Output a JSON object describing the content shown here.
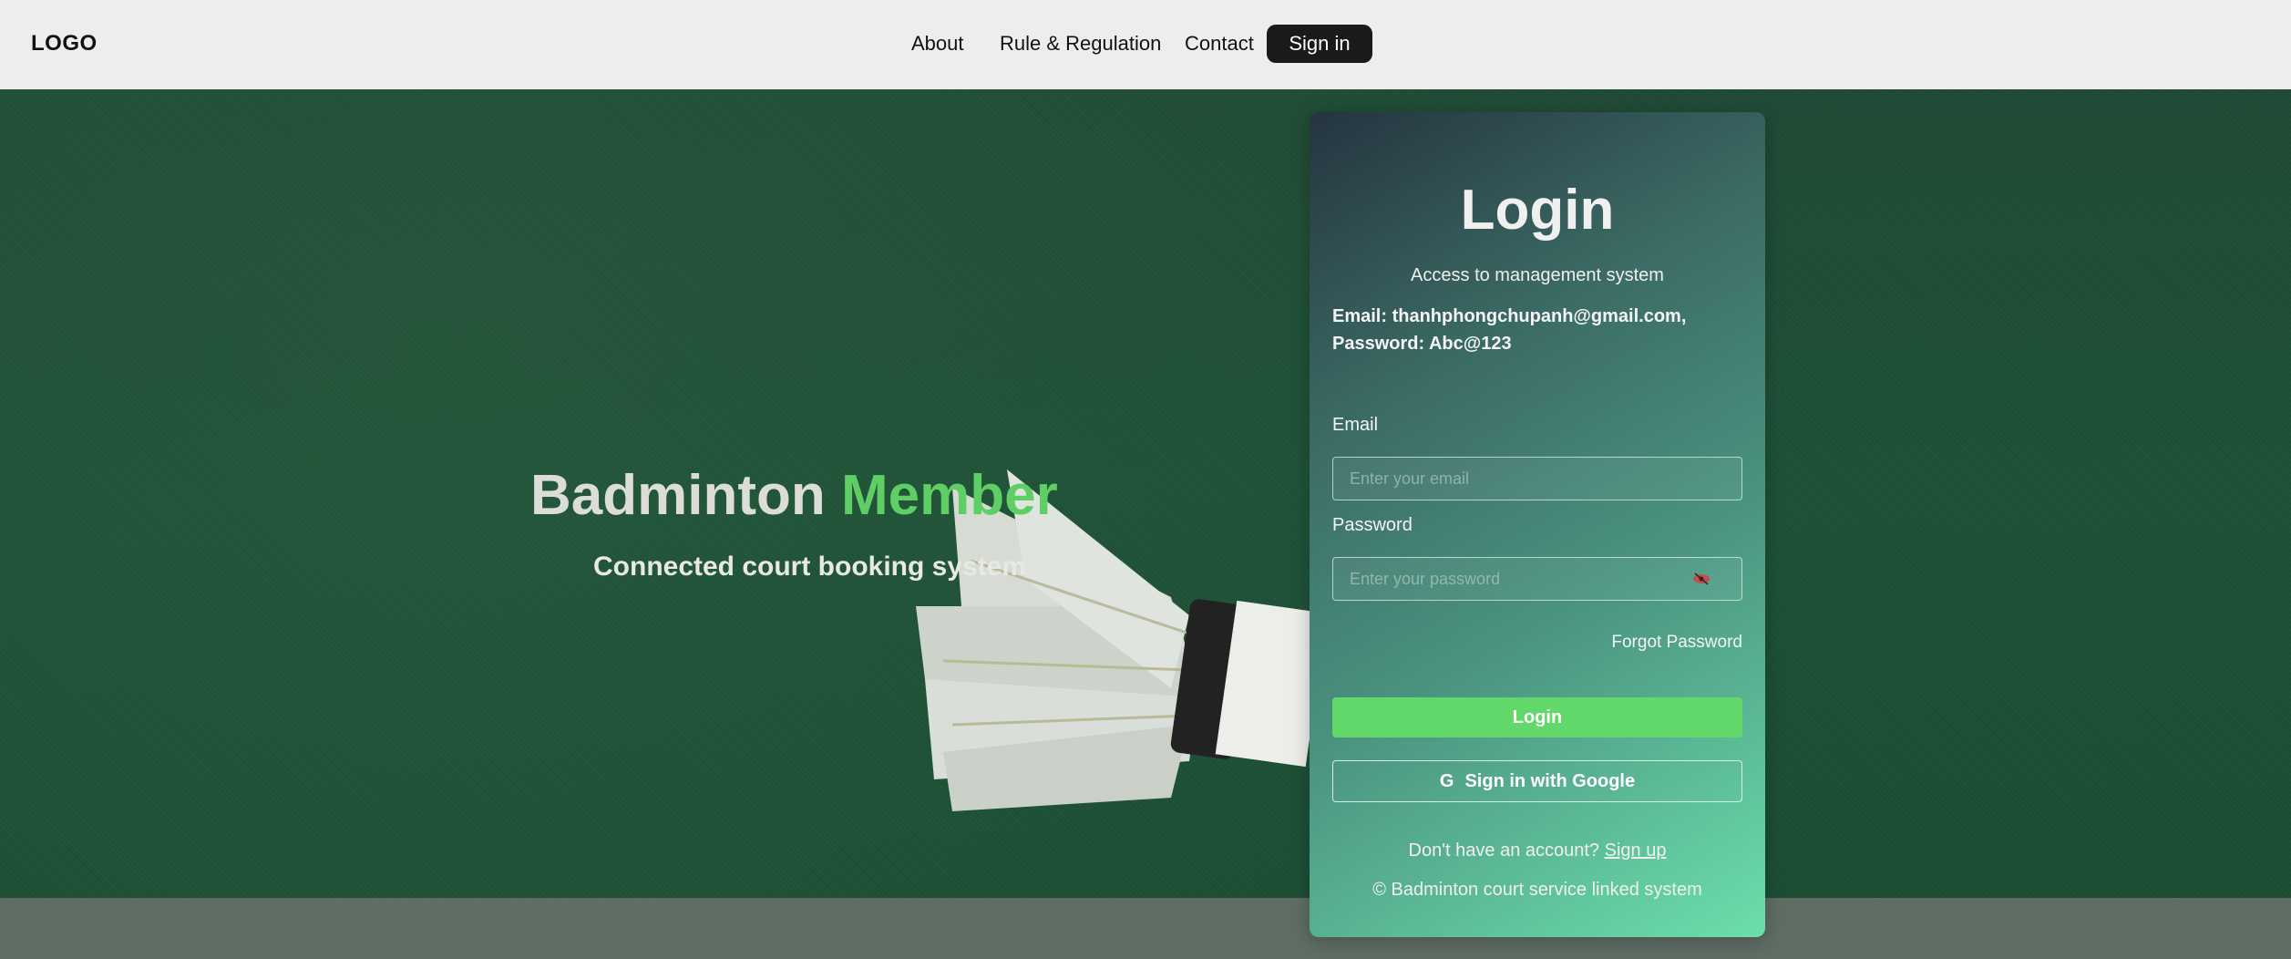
{
  "nav": {
    "logo": "LOGO",
    "links": [
      "About",
      "Rule & Regulation",
      "Contact"
    ],
    "signin_label": "Sign in"
  },
  "hero": {
    "title_main": "Badminton",
    "title_accent": "Member",
    "subtitle": "Connected court booking system"
  },
  "login": {
    "title": "Login",
    "subtitle": "Access to management system",
    "hint": "Email: thanhphongchupanh@gmail.com, Password: Abc@123",
    "email_label": "Email",
    "email_placeholder": "Enter your email",
    "email_value": "",
    "password_label": "Password",
    "password_placeholder": "Enter your password",
    "password_value": "",
    "forgot_label": "Forgot Password",
    "login_button": "Login",
    "google_button": "Sign in with Google",
    "no_account_text": "Don't have an account?",
    "signup_label": "Sign up",
    "copyright": "© Badminton court service linked system"
  },
  "colors": {
    "accent_green": "#5fce64",
    "login_button": "#62d76a",
    "nav_bg": "#ededed"
  },
  "icons": {
    "eye": "eye-slash-icon",
    "google": "google-icon"
  }
}
